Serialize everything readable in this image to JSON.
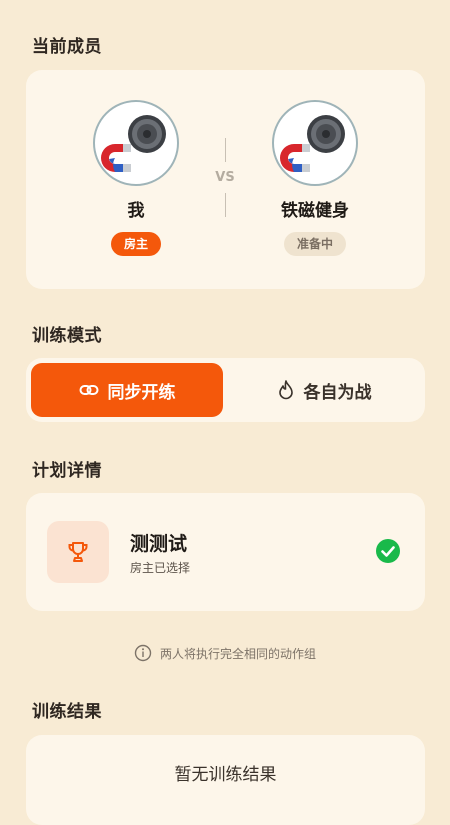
{
  "sections": {
    "members_title": "当前成员",
    "mode_title": "训练模式",
    "plan_title": "计划详情",
    "result_title": "训练结果"
  },
  "members": [
    {
      "name": "我",
      "badge": "房主",
      "avatar_icon": "magnet-dumbbell-icon"
    },
    {
      "name": "铁磁健身",
      "badge": "准备中",
      "avatar_icon": "magnet-dumbbell-icon"
    }
  ],
  "vs_label": "VS",
  "modes": [
    {
      "label": "同步开练",
      "icon": "link-icon",
      "active": true
    },
    {
      "label": "各自为战",
      "icon": "flame-icon",
      "active": false
    }
  ],
  "plan": {
    "name": "测测试",
    "status": "房主已选择",
    "icon": "trophy-icon",
    "selected": true
  },
  "hint": "两人将执行完全相同的动作组",
  "results": {
    "empty_text": "暂无训练结果"
  },
  "colors": {
    "accent": "#f4580b",
    "background": "#f8ebd4",
    "card": "#fdf6ea",
    "success": "#19b94a"
  }
}
